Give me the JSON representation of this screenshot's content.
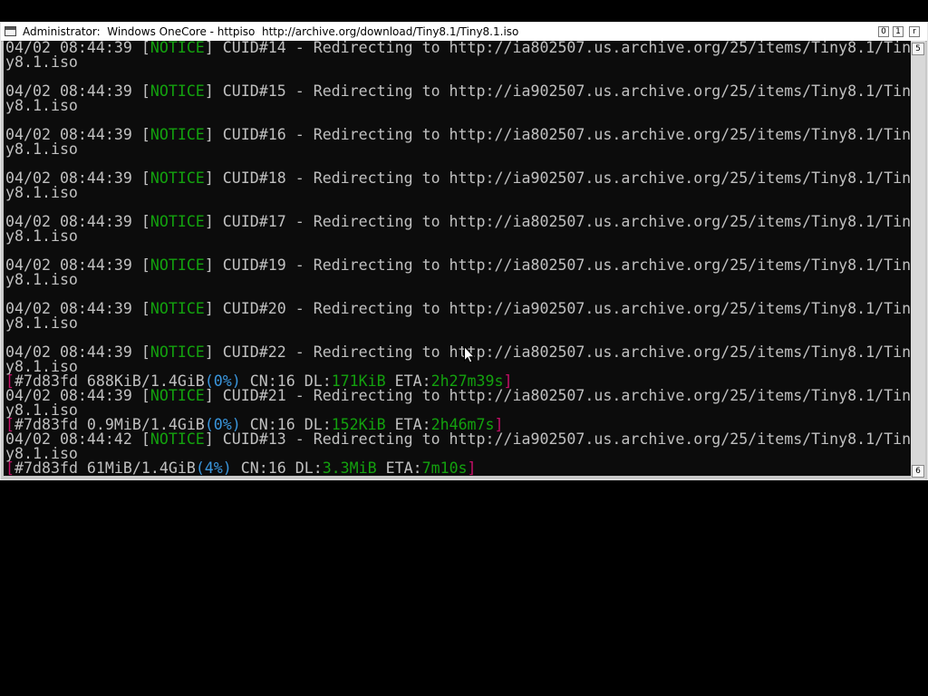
{
  "window": {
    "title": "Administrator:  Windows OneCore - httpiso  http://archive.org/download/Tiny8.1/Tiny8.1.iso",
    "controls": {
      "minimize": "0",
      "maximize": "1",
      "close": "r"
    }
  },
  "scrollbar": {
    "up": "5",
    "down": "6"
  },
  "console": {
    "lines": [
      {
        "type": "notice",
        "ts": "04/02 08:44:39 ",
        "tag": "NOTICE",
        "msg": " CUID#14 - Redirecting to http://ia802507.us.archive.org/25/items/Tiny8.1/Tin",
        "cont": "y8.1.iso"
      },
      {
        "type": "notice",
        "ts": "04/02 08:44:39 ",
        "tag": "NOTICE",
        "msg": " CUID#15 - Redirecting to http://ia902507.us.archive.org/25/items/Tiny8.1/Tin",
        "cont": "y8.1.iso"
      },
      {
        "type": "notice",
        "ts": "04/02 08:44:39 ",
        "tag": "NOTICE",
        "msg": " CUID#16 - Redirecting to http://ia802507.us.archive.org/25/items/Tiny8.1/Tin",
        "cont": "y8.1.iso"
      },
      {
        "type": "notice",
        "ts": "04/02 08:44:39 ",
        "tag": "NOTICE",
        "msg": " CUID#18 - Redirecting to http://ia902507.us.archive.org/25/items/Tiny8.1/Tin",
        "cont": "y8.1.iso"
      },
      {
        "type": "notice",
        "ts": "04/02 08:44:39 ",
        "tag": "NOTICE",
        "msg": " CUID#17 - Redirecting to http://ia802507.us.archive.org/25/items/Tiny8.1/Tin",
        "cont": "y8.1.iso"
      },
      {
        "type": "notice",
        "ts": "04/02 08:44:39 ",
        "tag": "NOTICE",
        "msg": " CUID#19 - Redirecting to http://ia802507.us.archive.org/25/items/Tiny8.1/Tin",
        "cont": "y8.1.iso"
      },
      {
        "type": "notice",
        "ts": "04/02 08:44:39 ",
        "tag": "NOTICE",
        "msg": " CUID#20 - Redirecting to http://ia902507.us.archive.org/25/items/Tiny8.1/Tin",
        "cont": "y8.1.iso"
      },
      {
        "type": "notice",
        "ts": "04/02 08:44:39 ",
        "tag": "NOTICE",
        "msg": " CUID#22 - Redirecting to http://ia802507.us.archive.org/25/items/Tiny8.1/Tin",
        "cont": "y8.1.iso"
      },
      {
        "type": "progress",
        "id": "#7d83fd",
        "size": " 688KiB/1.4GiB",
        "pct": "(0%)",
        "cn": " CN:16 DL:",
        "dl": "171KiB",
        "eta_label": " ETA:",
        "eta": "2h27m39s"
      },
      {
        "type": "notice",
        "ts": "04/02 08:44:39 ",
        "tag": "NOTICE",
        "msg": " CUID#21 - Redirecting to http://ia802507.us.archive.org/25/items/Tiny8.1/Tin",
        "cont": "y8.1.iso"
      },
      {
        "type": "progress",
        "id": "#7d83fd",
        "size": " 0.9MiB/1.4GiB",
        "pct": "(0%)",
        "cn": " CN:16 DL:",
        "dl": "152KiB",
        "eta_label": " ETA:",
        "eta": "2h46m7s"
      },
      {
        "type": "notice",
        "ts": "04/02 08:44:42 ",
        "tag": "NOTICE",
        "msg": " CUID#13 - Redirecting to http://ia902507.us.archive.org/25/items/Tiny8.1/Tin",
        "cont": "y8.1.iso"
      },
      {
        "type": "progress",
        "id": "#7d83fd",
        "size": " 61MiB/1.4GiB",
        "pct": "(4%)",
        "cn": " CN:16 DL:",
        "dl": "3.3MiB",
        "eta_label": " ETA:",
        "eta": "7m10s"
      }
    ]
  },
  "colors": {
    "notice": "#13a10e",
    "percent": "#3a96dd",
    "bracket": "#c50f67",
    "text": "#c0c0c0",
    "background": "#0c0c0c"
  },
  "cursor_icon": "mouse-pointer-icon"
}
